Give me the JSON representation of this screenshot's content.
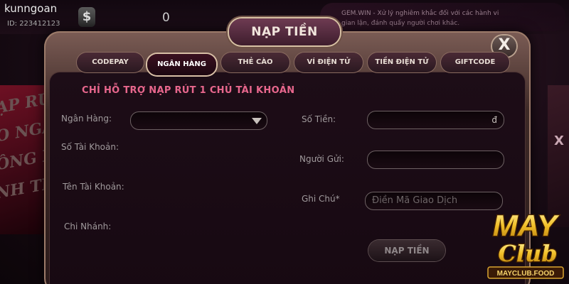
{
  "topbar": {
    "username": "kunngoan",
    "user_id": "ID: 223412123",
    "balance": "0",
    "ticker": "GEM.WIN - Xử lý nghiêm khắc đối với các hành vi gian lận, đánh quấy người chơi khác."
  },
  "background_promo": {
    "lines": [
      "ẠP RÚ",
      "O NGAY",
      "ÔNG NG",
      "NH TRẢ"
    ],
    "right_badge": "X"
  },
  "dialog": {
    "title": "NẠP TIỀN",
    "close_label": "X",
    "tabs": [
      {
        "label": "CODEPAY",
        "active": false
      },
      {
        "label": "NGÂN HÀNG",
        "active": true
      },
      {
        "label": "THẺ CÀO",
        "active": false
      },
      {
        "label": "VÍ ĐIỆN TỬ",
        "active": false
      },
      {
        "label": "TIỀN ĐIỆN TỬ",
        "active": false
      },
      {
        "label": "GIFTCODE",
        "active": false
      }
    ],
    "notice": "CHỈ HỖ TRỢ NẠP RÚT 1 CHỦ TÀI KHOẢN",
    "left_form": {
      "bank_label": "Ngân Hàng:",
      "bank_value": "",
      "account_number_label": "Số Tài Khoản:",
      "account_name_label": "Tên Tài Khoản:",
      "branch_label": "Chi Nhánh:"
    },
    "right_form": {
      "amount_label": "Số Tiền:",
      "amount_value": "",
      "currency": "đ",
      "sender_label": "Người Gửi:",
      "sender_value": "",
      "note_label": "Ghi Chú*",
      "note_placeholder": "Điền Mã Giao Dịch"
    },
    "submit_label": "NẠP TIỀN"
  },
  "logo": {
    "line1": "MAY",
    "line2": "Club",
    "domain": "MAYCLUB.FOOD"
  },
  "colors": {
    "notice": "#e8678d",
    "logo_gold": "#f2c029",
    "dialog_frame": "#7b5c55"
  }
}
